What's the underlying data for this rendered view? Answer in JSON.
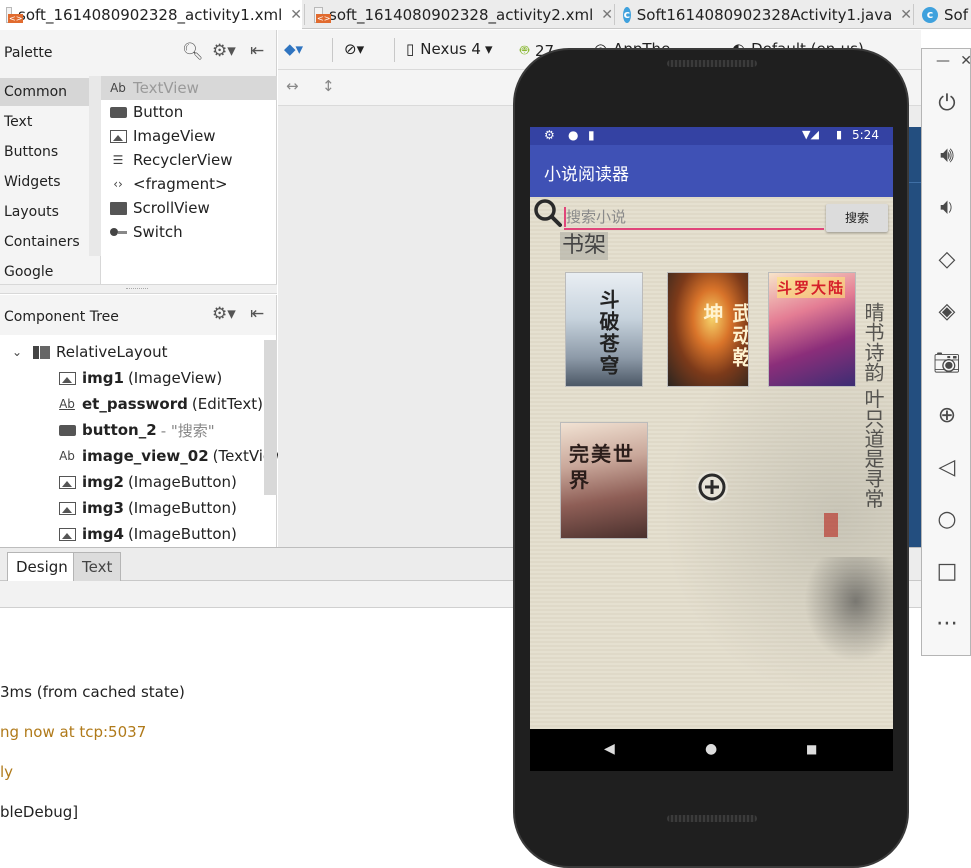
{
  "tabs": [
    {
      "label": "soft_1614080902328_activity1.xml",
      "icon": "xml-file-icon",
      "active": true
    },
    {
      "label": "soft_1614080902328_activity2.xml",
      "icon": "xml-file-icon",
      "active": false
    },
    {
      "label": "Soft1614080902328Activity1.java",
      "icon": "java-class-icon",
      "active": false
    },
    {
      "label": "Sof",
      "icon": "java-class-icon",
      "active": false
    }
  ],
  "palette": {
    "title": "Palette",
    "categories": [
      "Common",
      "Text",
      "Buttons",
      "Widgets",
      "Layouts",
      "Containers",
      "Google"
    ],
    "selected_category": "Common",
    "items": [
      {
        "label": "TextView",
        "icon": "textview-icon",
        "prefix": "Ab"
      },
      {
        "label": "Button",
        "icon": "button-icon"
      },
      {
        "label": "ImageView",
        "icon": "imageview-icon"
      },
      {
        "label": "RecyclerView",
        "icon": "recyclerview-icon"
      },
      {
        "label": "<fragment>",
        "icon": "fragment-icon"
      },
      {
        "label": "ScrollView",
        "icon": "scrollview-icon"
      },
      {
        "label": "Switch",
        "icon": "switch-icon"
      }
    ]
  },
  "component_tree": {
    "title": "Component Tree",
    "root": "RelativeLayout",
    "items": [
      {
        "name": "img1",
        "type": "(ImageView)",
        "hint": ""
      },
      {
        "name": "et_password",
        "type": "(EditText)",
        "hint": ""
      },
      {
        "name": "button_2",
        "type": "",
        "hint": "- \"搜索\""
      },
      {
        "name": "image_view_02",
        "type": "(TextView)",
        "hint": ""
      },
      {
        "name": "img2",
        "type": "(ImageButton)",
        "hint": ""
      },
      {
        "name": "img3",
        "type": "(ImageButton)",
        "hint": ""
      },
      {
        "name": "img4",
        "type": "(ImageButton)",
        "hint": ""
      }
    ]
  },
  "design_toolbar": {
    "device": "Nexus 4",
    "api": "27",
    "theme": "AppThe",
    "locale": "Default (en-us)"
  },
  "bottom_tabs": {
    "design": "Design",
    "text": "Text"
  },
  "console": [
    {
      "text": "3ms (from cached state)",
      "kind": "norm"
    },
    {
      "text": "ng now at tcp:5037",
      "kind": "warn"
    },
    {
      "text": "ly",
      "kind": "warn"
    },
    {
      "text": "bleDebug]",
      "kind": "norm"
    }
  ],
  "phone": {
    "status_time": "5:24",
    "app_title": "小说阅读器",
    "search_placeholder": "搜索小说",
    "search_button": "搜索",
    "shelf_label": "书架",
    "books": [
      {
        "title": "斗破苍穹"
      },
      {
        "title": "武动乾坤"
      },
      {
        "title": "斗罗大陆"
      },
      {
        "title": "完美世界"
      }
    ],
    "calligraphy": "晴书诗韵\n叶只道是寻常",
    "nav": {
      "back": "◀",
      "home": "●",
      "recents": "■"
    }
  },
  "emulator_tools": [
    "power-icon",
    "volume-up-icon",
    "volume-down-icon",
    "rotate-left-icon",
    "rotate-right-icon",
    "camera-icon",
    "zoom-icon",
    "back-icon",
    "home-icon",
    "overview-icon",
    "more-icon"
  ],
  "colors": {
    "app_bar": "#3f51b5",
    "status_bar": "#3442a3",
    "accent": "#e0457a",
    "blueprint": "#234e7f"
  }
}
